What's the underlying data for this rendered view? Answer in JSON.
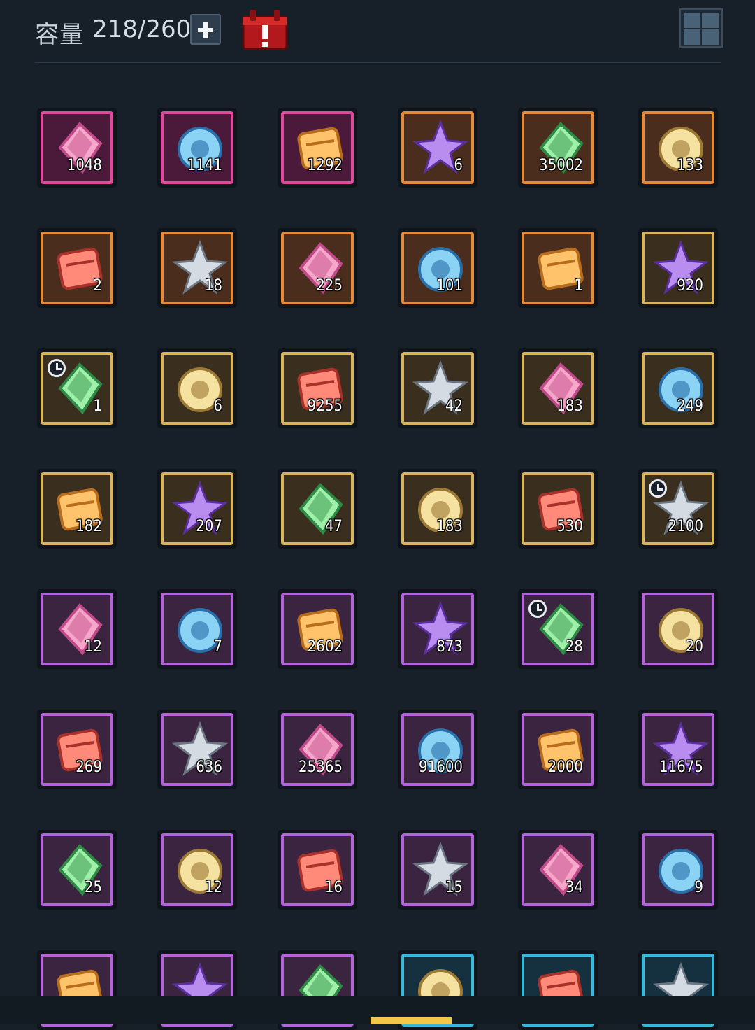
{
  "header": {
    "capacity_label": "容量",
    "capacity_value": "218/260",
    "add_icon": "plus-icon",
    "event_icon": "red-calendar-alert-icon",
    "grid_icon": "grid-view-icon"
  },
  "items": [
    {
      "icon": "pink-crystal-sword-icon",
      "count": "1048",
      "rarity": "pink"
    },
    {
      "icon": "pink-crystal-ring-icon",
      "count": "1141",
      "rarity": "pink"
    },
    {
      "icon": "pink-crystal-armor-icon",
      "count": "1292",
      "rarity": "pink"
    },
    {
      "icon": "angel-heal-emblem-icon",
      "count": "6",
      "rarity": "orange"
    },
    {
      "icon": "copper-crystal-icon",
      "count": "35002",
      "rarity": "orange"
    },
    {
      "icon": "herb-pouch-icon",
      "count": "133",
      "rarity": "orange"
    },
    {
      "icon": "magic-cube-icon",
      "count": "2",
      "rarity": "orange"
    },
    {
      "icon": "green-potion-icon",
      "count": "18",
      "rarity": "orange"
    },
    {
      "icon": "dark-crystal-icon",
      "count": "225",
      "rarity": "orange"
    },
    {
      "icon": "hourglass-icon",
      "count": "101",
      "rarity": "orange"
    },
    {
      "icon": "gear-gem-icon",
      "count": "1",
      "rarity": "orange"
    },
    {
      "icon": "golden-crest-icon",
      "count": "920",
      "rarity": "gold"
    },
    {
      "icon": "seashell-icon",
      "count": "1",
      "rarity": "gold",
      "timer": true
    },
    {
      "icon": "purple-star-shard-icon",
      "count": "6",
      "rarity": "gold"
    },
    {
      "icon": "orange-star-shard-icon",
      "count": "9255",
      "rarity": "gold"
    },
    {
      "icon": "pink-orb-icon",
      "count": "42",
      "rarity": "gold"
    },
    {
      "icon": "cloth-bundle-icon",
      "count": "183",
      "rarity": "gold"
    },
    {
      "icon": "thread-spool-icon",
      "count": "249",
      "rarity": "gold"
    },
    {
      "icon": "red-leather-icon",
      "count": "182",
      "rarity": "gold"
    },
    {
      "icon": "silver-ingot-icon",
      "count": "207",
      "rarity": "gold"
    },
    {
      "icon": "leather-envelope-icon",
      "count": "47",
      "rarity": "gold"
    },
    {
      "icon": "gem-cluster-icon",
      "count": "183",
      "rarity": "gold"
    },
    {
      "icon": "green-flask-icon",
      "count": "530",
      "rarity": "gold"
    },
    {
      "icon": "skull-shell-icon",
      "count": "2100",
      "rarity": "gold",
      "timer": true
    },
    {
      "icon": "bread-icon",
      "count": "12",
      "rarity": "purple"
    },
    {
      "icon": "cupcake-icon",
      "count": "7",
      "rarity": "purple"
    },
    {
      "icon": "blue-scroll-icon",
      "count": "2602",
      "rarity": "purple"
    },
    {
      "icon": "green-scroll-icon",
      "count": "873",
      "rarity": "purple"
    },
    {
      "icon": "rice-dumpling-icon",
      "count": "28",
      "rarity": "purple",
      "timer": true
    },
    {
      "icon": "blue-map-icon",
      "count": "20",
      "rarity": "purple"
    },
    {
      "icon": "clay-pot-icon",
      "count": "269",
      "rarity": "purple"
    },
    {
      "icon": "blue-stone-ring-icon",
      "count": "636",
      "rarity": "purple"
    },
    {
      "icon": "purple-fang-icon",
      "count": "25365",
      "rarity": "purple"
    },
    {
      "icon": "amethyst-icon",
      "count": "91600",
      "rarity": "purple"
    },
    {
      "icon": "pink-gem-icon",
      "count": "2000",
      "rarity": "purple"
    },
    {
      "icon": "star-medal-icon",
      "count": "11675",
      "rarity": "purple"
    },
    {
      "icon": "pink-cloth-icon",
      "count": "25",
      "rarity": "purple"
    },
    {
      "icon": "yarn-roll-icon",
      "count": "12",
      "rarity": "purple"
    },
    {
      "icon": "red-ribbon-icon",
      "count": "16",
      "rarity": "purple"
    },
    {
      "icon": "grey-ore-icon",
      "count": "15",
      "rarity": "purple"
    },
    {
      "icon": "brown-envelope-icon",
      "count": "34",
      "rarity": "purple"
    },
    {
      "icon": "gem-blocks-icon",
      "count": "9",
      "rarity": "purple"
    },
    {
      "icon": "wood-box-icon",
      "count": "",
      "rarity": "purple"
    },
    {
      "icon": "yellow-scroll-icon",
      "count": "",
      "rarity": "purple"
    },
    {
      "icon": "fire-emblem-icon",
      "count": "",
      "rarity": "purple"
    },
    {
      "icon": "ice-crystal-icon",
      "count": "",
      "rarity": "cyan"
    },
    {
      "icon": "lava-rock-icon",
      "count": "",
      "rarity": "cyan"
    },
    {
      "icon": "dark-ore-icon",
      "count": "",
      "rarity": "cyan"
    }
  ]
}
